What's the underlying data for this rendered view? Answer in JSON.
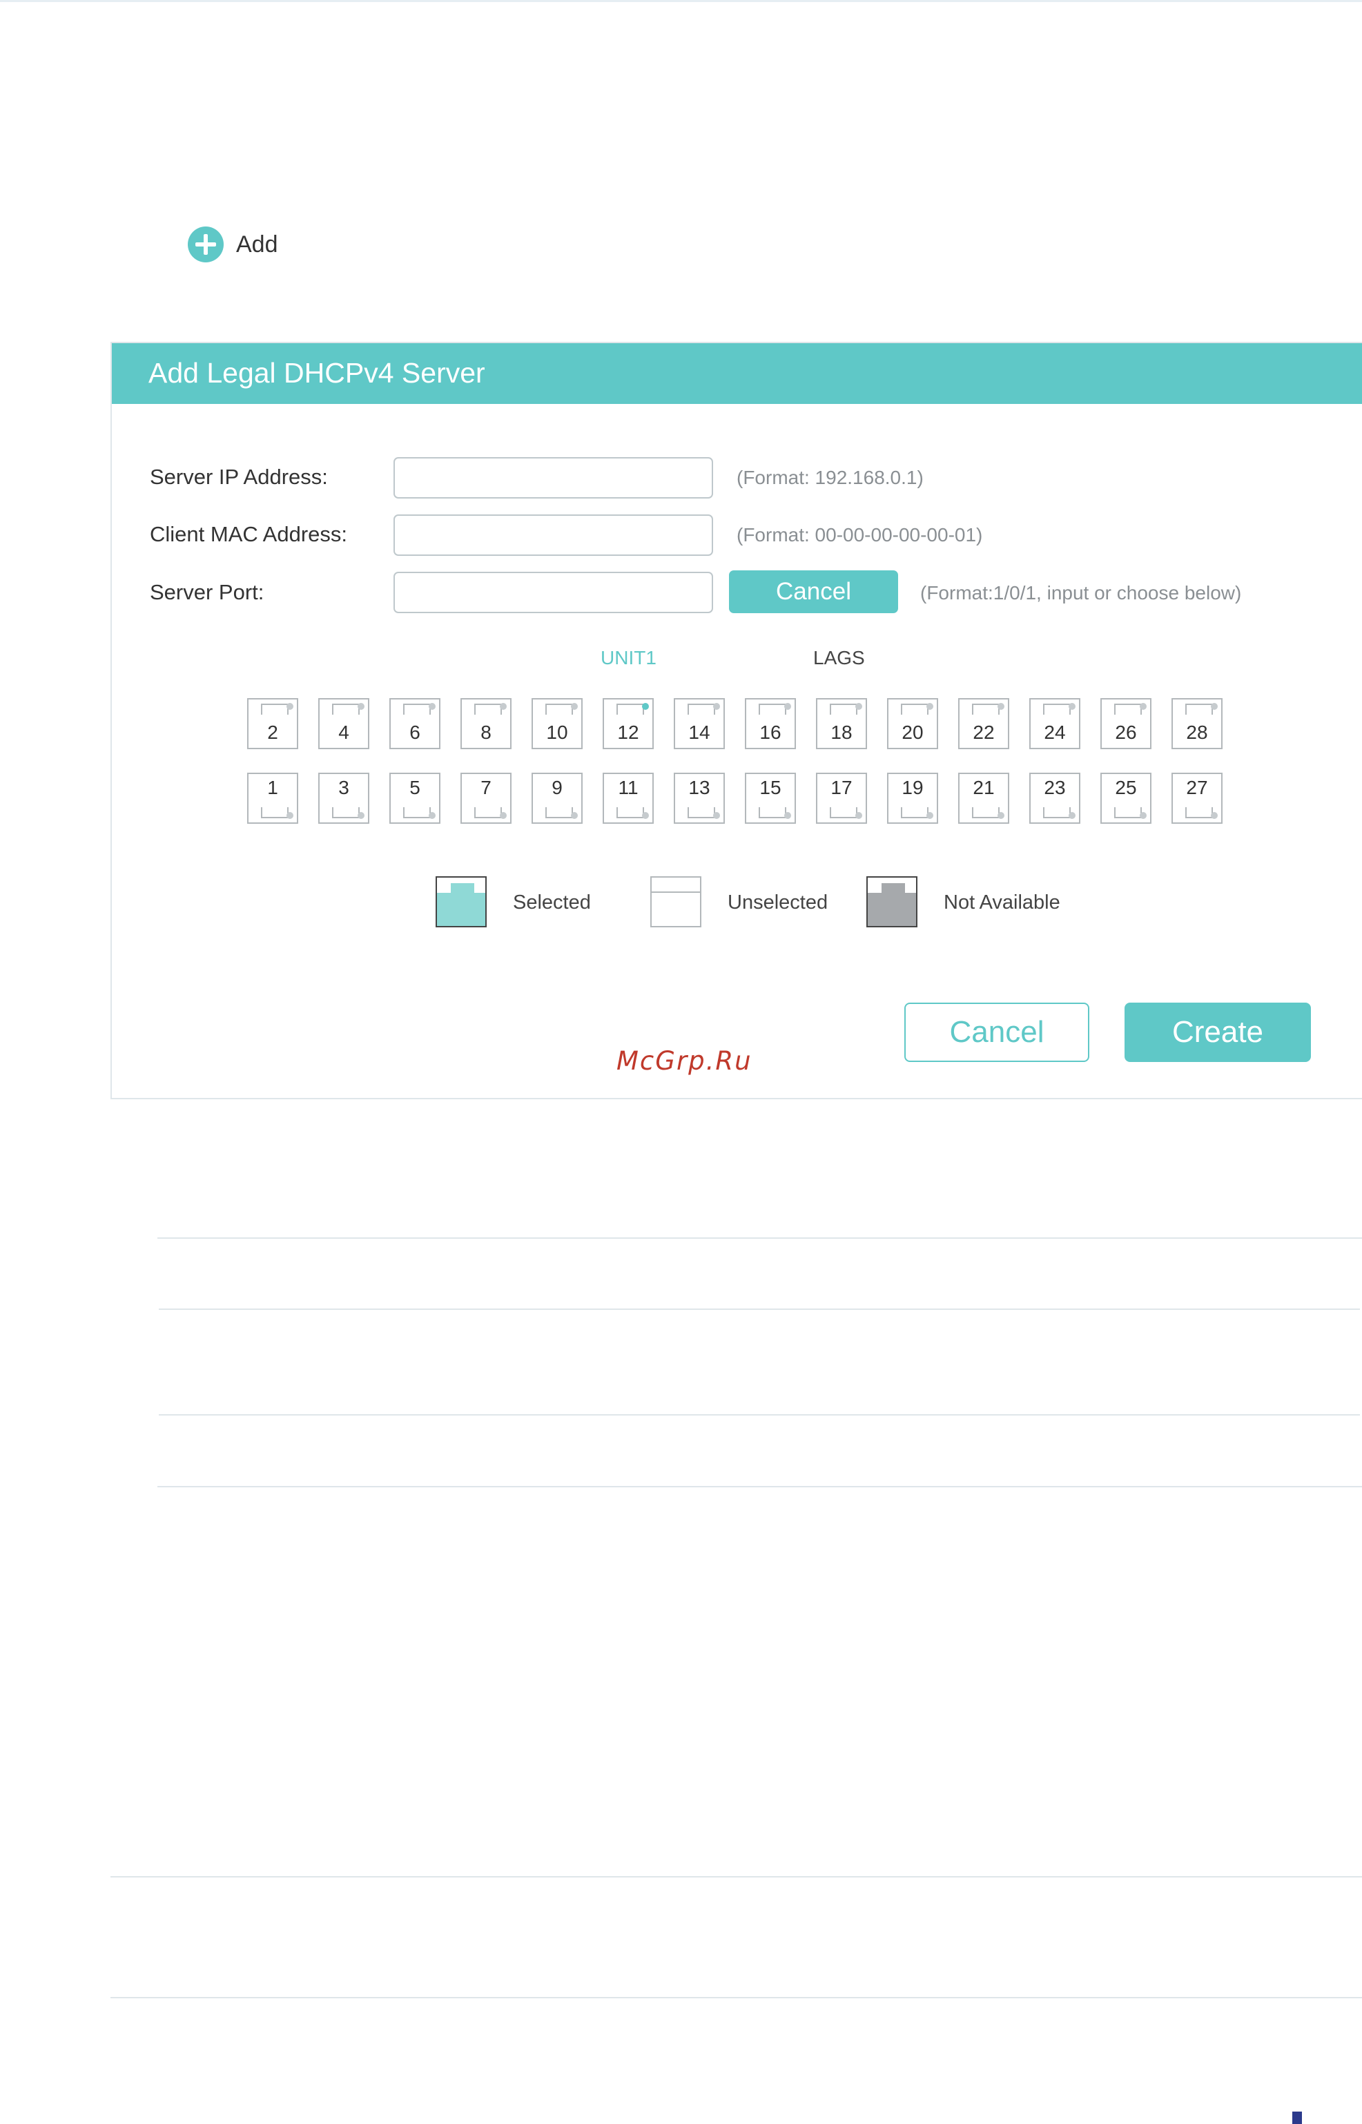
{
  "toolbar": {
    "add_label": "Add"
  },
  "dialog": {
    "title": "Add Legal DHCPv4 Server",
    "fields": {
      "server_ip": {
        "label": "Server IP Address:",
        "value": "",
        "hint": "(Format: 192.168.0.1)"
      },
      "client_mac": {
        "label": "Client MAC Address:",
        "value": "",
        "hint": "(Format: 00-00-00-00-00-01)"
      },
      "server_port": {
        "label": "Server Port:",
        "value": "",
        "hint": "(Format:1/0/1, input or choose below)",
        "cancel_label": "Cancel"
      }
    },
    "tabs": {
      "unit": "UNIT1",
      "lags": "LAGS"
    },
    "ports_top": [
      {
        "label": "2",
        "active": false
      },
      {
        "label": "4",
        "active": false
      },
      {
        "label": "6",
        "active": false
      },
      {
        "label": "8",
        "active": false
      },
      {
        "label": "10",
        "active": false
      },
      {
        "label": "12",
        "active": true
      },
      {
        "label": "14",
        "active": false
      },
      {
        "label": "16",
        "active": false
      },
      {
        "label": "18",
        "active": false
      },
      {
        "label": "20",
        "active": false
      },
      {
        "label": "22",
        "active": false
      },
      {
        "label": "24",
        "active": false
      },
      {
        "label": "26",
        "active": false
      },
      {
        "label": "28",
        "active": false
      }
    ],
    "ports_bottom": [
      {
        "label": "1",
        "active": false
      },
      {
        "label": "3",
        "active": false
      },
      {
        "label": "5",
        "active": false
      },
      {
        "label": "7",
        "active": false
      },
      {
        "label": "9",
        "active": false
      },
      {
        "label": "11",
        "active": false
      },
      {
        "label": "13",
        "active": false
      },
      {
        "label": "15",
        "active": false
      },
      {
        "label": "17",
        "active": false
      },
      {
        "label": "19",
        "active": false
      },
      {
        "label": "21",
        "active": false
      },
      {
        "label": "23",
        "active": false
      },
      {
        "label": "25",
        "active": false
      },
      {
        "label": "27",
        "active": false
      }
    ],
    "legend": {
      "selected": {
        "label": "Selected",
        "color": "#8fd9d6"
      },
      "unselected": {
        "label": "Unselected",
        "color": "#ffffff"
      },
      "not_available": {
        "label": "Not Available",
        "color": "#a6a9ac"
      }
    },
    "buttons": {
      "cancel": "Cancel",
      "create": "Create"
    }
  },
  "watermark": "McGrp.Ru",
  "colors": {
    "accent": "#5fc8c7",
    "led_active": "#5fc8c7",
    "led_idle": "#c6cbce",
    "border": "#b3b8bb"
  }
}
